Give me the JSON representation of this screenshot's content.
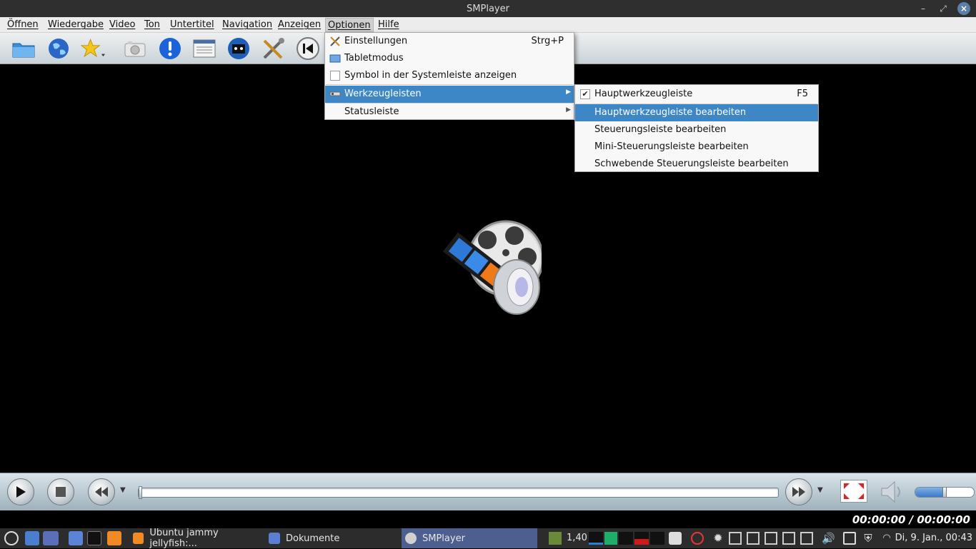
{
  "window": {
    "title": "SMPlayer"
  },
  "menubar": {
    "items": [
      {
        "label": "Öffnen"
      },
      {
        "label": "Wiedergabe"
      },
      {
        "label": "Video"
      },
      {
        "label": "Ton"
      },
      {
        "label": "Untertitel"
      },
      {
        "label": "Navigation"
      },
      {
        "label": "Anzeigen"
      },
      {
        "label": "Optionen"
      },
      {
        "label": "Hilfe"
      }
    ]
  },
  "options_menu": {
    "items": [
      {
        "label": "Einstellungen",
        "shortcut": "Strg+P",
        "icon": "wrench-screwdriver-icon"
      },
      {
        "label": "Tabletmodus",
        "icon": "tablet-icon"
      },
      {
        "label": "Symbol in der Systemleiste anzeigen",
        "checked": false
      },
      {
        "label": "Werkzeugleisten",
        "icon": "toolbar-icon",
        "submenu": true
      },
      {
        "label": "Statusleiste",
        "submenu": true
      }
    ]
  },
  "toolbars_submenu": {
    "items": [
      {
        "label": "Hauptwerkzeugleiste",
        "shortcut": "F5",
        "checked": true
      },
      {
        "label": "Hauptwerkzeugleiste bearbeiten"
      },
      {
        "label": "Steuerungsleiste bearbeiten"
      },
      {
        "label": "Mini-Steuerungsleiste bearbeiten"
      },
      {
        "label": "Schwebende Steuerungsleiste bearbeiten"
      }
    ]
  },
  "toolbar": {
    "icons": [
      "open-folder-icon",
      "globe-url-icon",
      "favorites-star-icon",
      "screenshot-camera-icon",
      "info-icon",
      "playlist-icon",
      "media-info-icon",
      "preferences-tools-icon",
      "previous-icon"
    ]
  },
  "player": {
    "progress": 0,
    "volume": 0.5,
    "time_display": "00:00:00 / 00:00:00"
  },
  "taskbar": {
    "tasks": [
      {
        "label": "Ubuntu jammy jellyfish:..."
      },
      {
        "label": "Dokumente"
      },
      {
        "label": "SMPlayer",
        "active": true
      }
    ],
    "load_value": "1,40",
    "clock": "Di, 9. Jan., 00:43"
  },
  "colors": {
    "highlight": "#3d87c6",
    "taskbar_active": "#4d5f8e",
    "titlebar": "#2f2f2f"
  }
}
